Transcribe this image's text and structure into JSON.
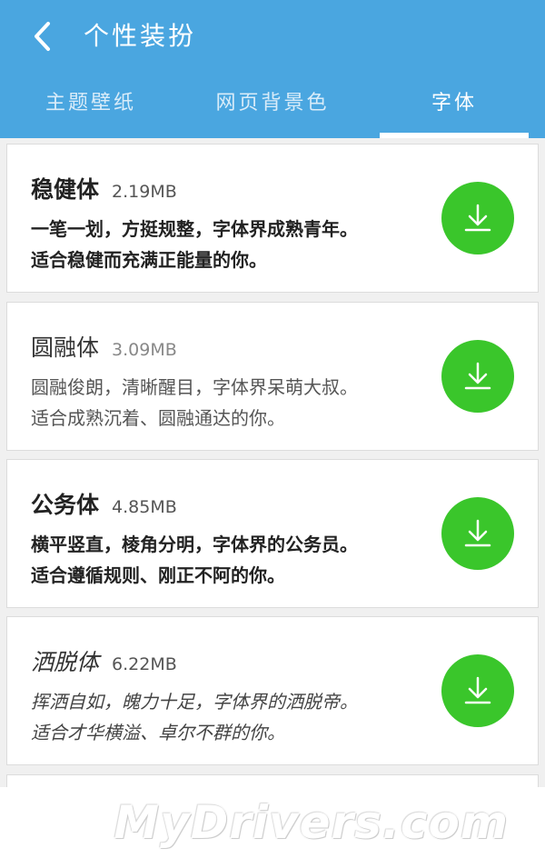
{
  "header": {
    "title": "个性装扮"
  },
  "tabs": [
    {
      "label": "主题壁纸",
      "active": false
    },
    {
      "label": "网页背景色",
      "active": false
    },
    {
      "label": "字体",
      "active": true
    }
  ],
  "fonts": [
    {
      "name": "稳健体",
      "size": "2.19MB",
      "desc_line1": "一笔一划，方挺规整，字体界成熟青年。",
      "desc_line2": "适合稳健而充满正能量的你。"
    },
    {
      "name": "圆融体",
      "size": "3.09MB",
      "desc_line1": "圆融俊朗，清晰醒目，字体界呆萌大叔。",
      "desc_line2": "适合成熟沉着、圆融通达的你。"
    },
    {
      "name": "公务体",
      "size": "4.85MB",
      "desc_line1": "横平竖直，棱角分明，字体界的公务员。",
      "desc_line2": "适合遵循规则、刚正不阿的你。"
    },
    {
      "name": "洒脱体",
      "size": "6.22MB",
      "desc_line1": "挥洒自如，魄力十足，字体界的洒脱帝。",
      "desc_line2": "适合才华横溢、卓尔不群的你。"
    }
  ],
  "watermark": "MyDrivers.com",
  "colors": {
    "header_bg": "#4aa6e0",
    "download_green": "#3ac62b",
    "page_bg": "#f0f0f0"
  },
  "icons": {
    "back": "chevron-left-icon",
    "download": "download-icon"
  }
}
